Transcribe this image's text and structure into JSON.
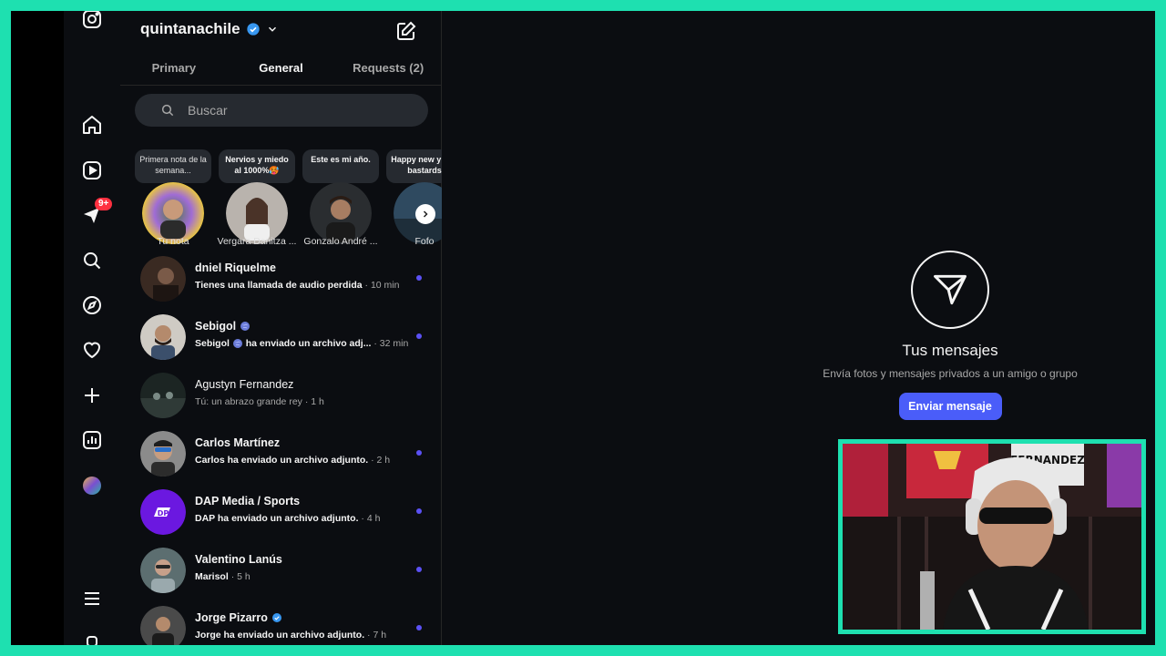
{
  "account": {
    "name": "quintanachile"
  },
  "tabs": [
    {
      "label": "Primary"
    },
    {
      "label": "General"
    },
    {
      "label": "Requests (2)"
    }
  ],
  "search": {
    "placeholder": "Buscar"
  },
  "nav": {
    "badge": "9+"
  },
  "notes": [
    {
      "note": "Primera nota de la semana...",
      "name": "Tu nota"
    },
    {
      "note": "Nervios y miedo al 1000%🥵",
      "name": "Vergara Danitza ..."
    },
    {
      "note": "Este es mi año.",
      "name": "Gonzalo André ..."
    },
    {
      "note": "Happy new y you bastards",
      "name": "Fofo"
    }
  ],
  "conversations": [
    {
      "name": "dniel Riquelme",
      "preview": "Tienes una llamada de audio perdida",
      "time": "· 10 min",
      "unread": true
    },
    {
      "name": "Sebigol",
      "preview": "Sebigol",
      "preview_rest": "ha enviado un archivo adj...",
      "time": "· 32 min",
      "unread": true
    },
    {
      "name": "Agustyn Fernandez",
      "preview": "Tú: un abrazo grande rey",
      "time": "· 1 h",
      "unread": false
    },
    {
      "name": "Carlos Martínez",
      "preview": "Carlos ha enviado un archivo adjunto.",
      "time": "· 2 h",
      "unread": true
    },
    {
      "name": "DAP Media / Sports",
      "preview": "DAP ha enviado un archivo adjunto.",
      "time": "· 4 h",
      "unread": true
    },
    {
      "name": "Valentino Lanús",
      "preview": "Marisol",
      "time": "· 5 h",
      "unread": true
    },
    {
      "name": "Jorge Pizarro",
      "preview": "Jorge ha enviado un archivo adjunto.",
      "time": "· 7 h",
      "unread": true
    }
  ],
  "empty_state": {
    "title": "Tus mensajes",
    "subtitle": "Envía fotos y mensajes privados a un amigo o grupo",
    "button": "Enviar mensaje"
  },
  "webcam": {
    "banner_text": "FERNANDEZ"
  },
  "colors": {
    "accent": "#4a5df9",
    "unread": "#5b51f5",
    "frame": "#1ee0b0",
    "badge": "#ff3040"
  }
}
